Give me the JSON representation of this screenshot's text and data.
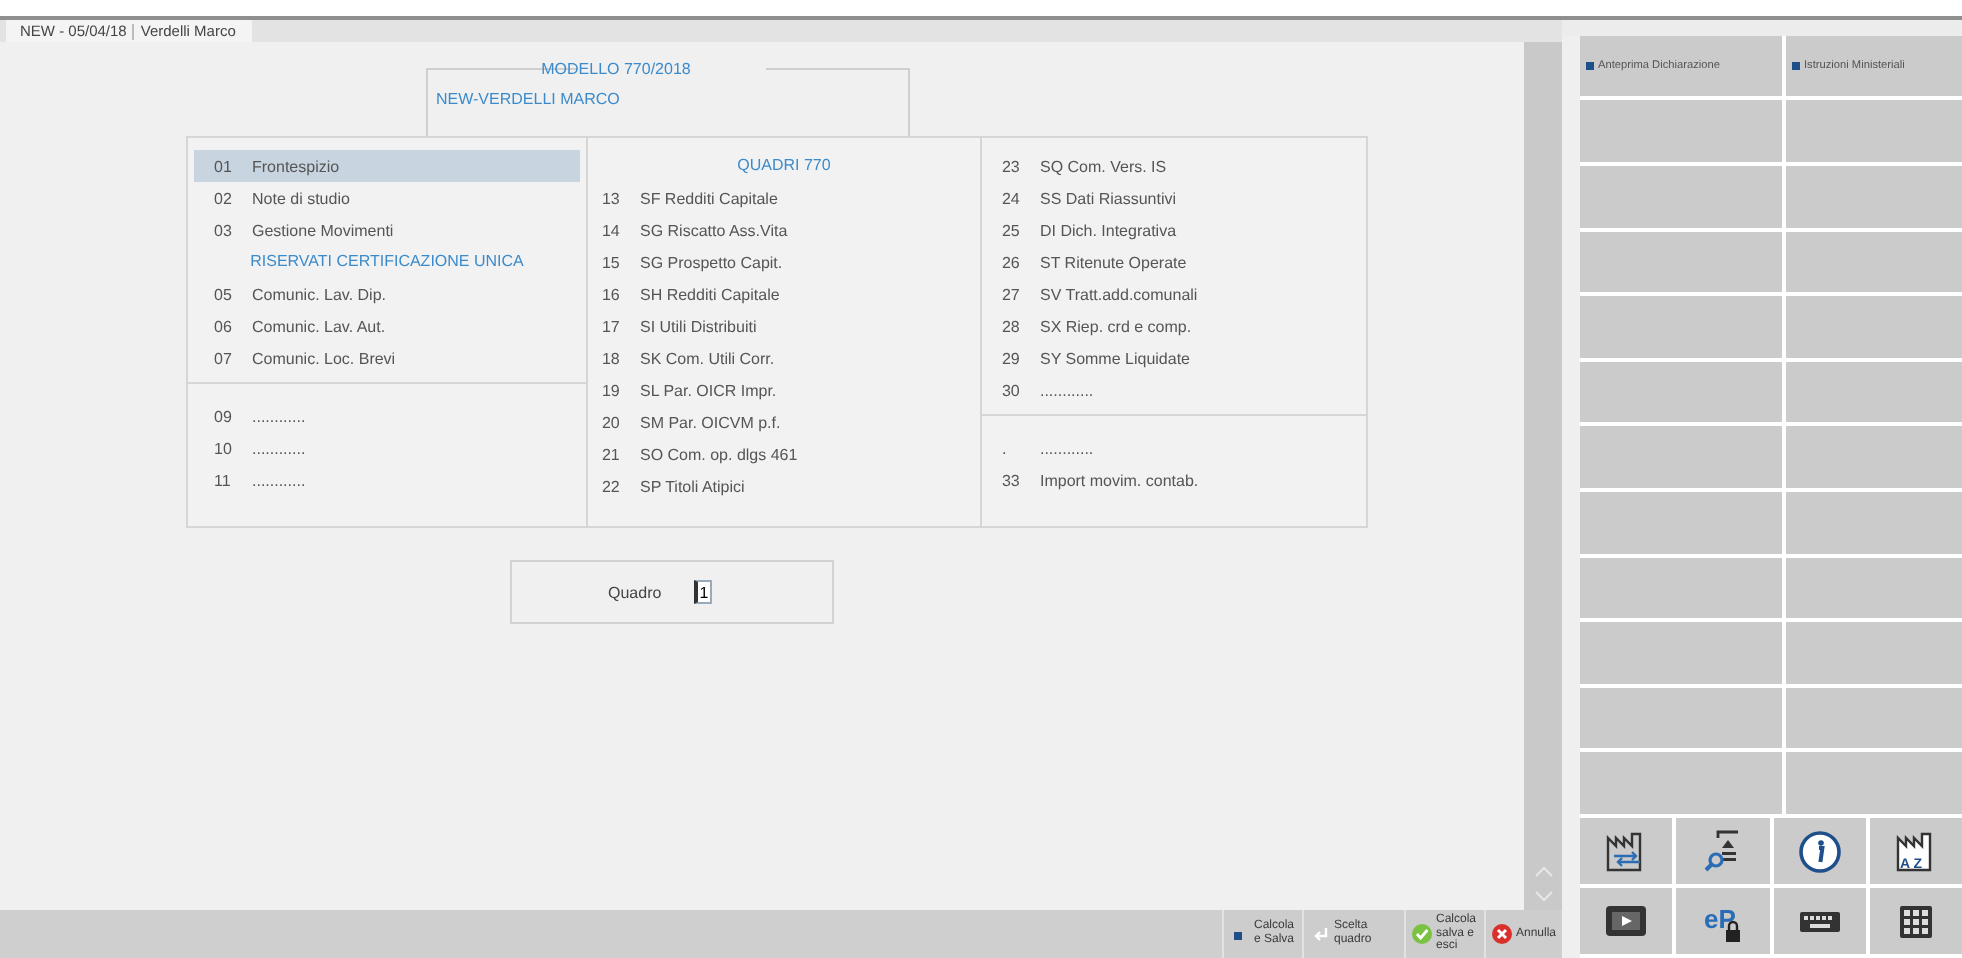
{
  "tab": {
    "date": "NEW - 05/04/18",
    "name": "Verdelli Marco"
  },
  "header": {
    "legend": "MODELLO 770/2018",
    "subject": "NEW-VERDELLI MARCO"
  },
  "columns": [
    {
      "sections": [
        {
          "items": [
            {
              "kind": "entry",
              "number": "01",
              "label": "Frontespizio",
              "selected": true
            },
            {
              "kind": "entry",
              "number": "02",
              "label": "Note di studio",
              "selected": false
            },
            {
              "kind": "entry",
              "number": "03",
              "label": "Gestione Movimenti",
              "selected": false
            },
            {
              "kind": "heading",
              "text": "RISERVATI CERTIFICAZIONE UNICA"
            },
            {
              "kind": "entry",
              "number": "05",
              "label": "Comunic. Lav. Dip.",
              "selected": false
            },
            {
              "kind": "entry",
              "number": "06",
              "label": "Comunic. Lav. Aut.",
              "selected": false
            },
            {
              "kind": "entry",
              "number": "07",
              "label": "Comunic. Loc. Brevi",
              "selected": false
            }
          ]
        },
        {
          "items": [
            {
              "kind": "entry",
              "number": "09",
              "label": "............",
              "selected": false
            },
            {
              "kind": "entry",
              "number": "10",
              "label": "............",
              "selected": false
            },
            {
              "kind": "entry",
              "number": "11",
              "label": "............",
              "selected": false
            }
          ]
        }
      ]
    },
    {
      "sections": [
        {
          "items": [
            {
              "kind": "heading",
              "text": "QUADRI 770"
            },
            {
              "kind": "entry",
              "number": "13",
              "label": "SF Redditi Capitale",
              "selected": false
            },
            {
              "kind": "entry",
              "number": "14",
              "label": "SG Riscatto Ass.Vita",
              "selected": false
            },
            {
              "kind": "entry",
              "number": "15",
              "label": "SG Prospetto Capit.",
              "selected": false
            },
            {
              "kind": "entry",
              "number": "16",
              "label": "SH Redditi Capitale",
              "selected": false
            },
            {
              "kind": "entry",
              "number": "17",
              "label": "SI Utili Distribuiti",
              "selected": false
            },
            {
              "kind": "entry",
              "number": "18",
              "label": "SK Com. Utili Corr.",
              "selected": false
            },
            {
              "kind": "entry",
              "number": "19",
              "label": "SL Par. OICR Impr.",
              "selected": false
            },
            {
              "kind": "entry",
              "number": "20",
              "label": "SM Par. OICVM p.f.",
              "selected": false
            },
            {
              "kind": "entry",
              "number": "21",
              "label": "SO Com. op. dlgs 461",
              "selected": false
            },
            {
              "kind": "entry",
              "number": "22",
              "label": "SP Titoli Atipici",
              "selected": false
            }
          ]
        }
      ]
    },
    {
      "sections": [
        {
          "items": [
            {
              "kind": "entry",
              "number": "23",
              "label": "SQ Com. Vers. IS",
              "selected": false
            },
            {
              "kind": "entry",
              "number": "24",
              "label": "SS Dati Riassuntivi",
              "selected": false
            },
            {
              "kind": "entry",
              "number": "25",
              "label": "DI Dich. Integrativa",
              "selected": false
            },
            {
              "kind": "entry",
              "number": "26",
              "label": "ST Ritenute Operate",
              "selected": false
            },
            {
              "kind": "entry",
              "number": "27",
              "label": "SV Tratt.add.comunali",
              "selected": false
            },
            {
              "kind": "entry",
              "number": "28",
              "label": "SX Riep. crd e comp.",
              "selected": false
            },
            {
              "kind": "entry",
              "number": "29",
              "label": "SY Somme Liquidate",
              "selected": false
            },
            {
              "kind": "entry",
              "number": "30",
              "label": "............",
              "selected": false
            }
          ]
        },
        {
          "items": [
            {
              "kind": "entry",
              "number": ".",
              "label": "............",
              "selected": false
            },
            {
              "kind": "entry",
              "number": "33",
              "label": "Import movim. contab.",
              "selected": false
            }
          ]
        }
      ]
    }
  ],
  "quadro": {
    "label": "Quadro",
    "value": "1"
  },
  "sidebar": {
    "links": [
      {
        "label": "Anteprima Dichiarazione"
      },
      {
        "label": "Istruzioni Ministeriali"
      }
    ],
    "tools": [
      {
        "kind": "factory-arrows"
      },
      {
        "kind": "search-document"
      },
      {
        "kind": "info"
      },
      {
        "kind": "factory-az",
        "text": "A Z"
      },
      {
        "kind": "monitor"
      },
      {
        "kind": "ep-lock",
        "text": "eP"
      },
      {
        "kind": "keyboard"
      },
      {
        "kind": "keypad"
      }
    ]
  },
  "actions": [
    {
      "kind": "square",
      "label": "Calcola e Salva"
    },
    {
      "kind": "enter",
      "label": "Scelta quadro"
    },
    {
      "kind": "check",
      "label": "Calcola salva e esci"
    },
    {
      "kind": "cancel",
      "label": "Annulla"
    }
  ]
}
